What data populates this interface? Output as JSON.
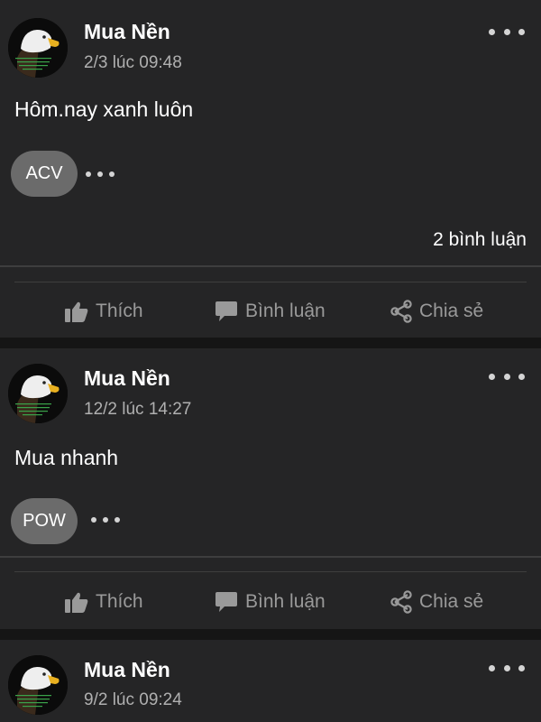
{
  "posts": [
    {
      "author": "Mua Nền",
      "time": "2/3 lúc 09:48",
      "content": "Hôm.nay xanh luôn",
      "tag": "ACV",
      "comments": "2 bình luận"
    },
    {
      "author": "Mua Nền",
      "time": "12/2 lúc 14:27",
      "content": "Mua nhanh",
      "tag": "POW"
    },
    {
      "author": "Mua Nền",
      "time": "9/2 lúc 09:24"
    }
  ],
  "actions": {
    "like": "Thích",
    "comment": "Bình luận",
    "share": "Chia sẻ"
  },
  "icons": {
    "like": "thumbs-up-icon",
    "comment": "speech-bubble-icon",
    "share": "share-icon",
    "more": "three-dots-icon",
    "avatar": "bald-eagle-avatar"
  },
  "colors": {
    "page_background": "#151515",
    "card_background": "#252526",
    "tag_background": "#6b6b6b",
    "action_text": "#9a9a9a"
  }
}
